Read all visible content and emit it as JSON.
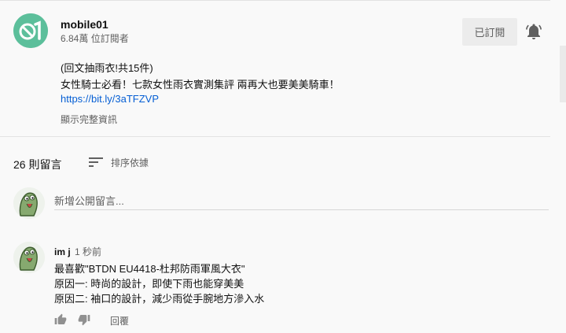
{
  "channel": {
    "name": "mobile01",
    "subscribers": "6.84萬 位訂閱者",
    "subscribed_label": "已訂閱",
    "avatar_color": "#5cbf9b",
    "bell_icon": "bell-icon"
  },
  "description": {
    "line1": "(回文抽雨衣!共15件)",
    "line2": "女性騎士必看！七款女性雨衣實測集評 兩再大也要美美騎車！",
    "link": "https://bit.ly/3aTFZVP",
    "show_more": "顯示完整資訊"
  },
  "comments_header": {
    "count": "26 則留言",
    "sort_label": "排序依據"
  },
  "add_comment": {
    "placeholder": "新增公開留言..."
  },
  "comments": [
    {
      "author": "im j",
      "time": "1 秒前",
      "lines": [
        "最喜歡\"BTDN EU4418-杜邦防雨軍風大衣\"",
        "原因一: 時尚的設計，即使下雨也能穿美美",
        "原因二: 袖口的設計，減少雨從手腕地方滲入水"
      ],
      "reply_label": "回覆"
    }
  ],
  "colors": {
    "link": "#065fd4",
    "secondary_text": "#606060",
    "background": "#f9f9f9"
  }
}
